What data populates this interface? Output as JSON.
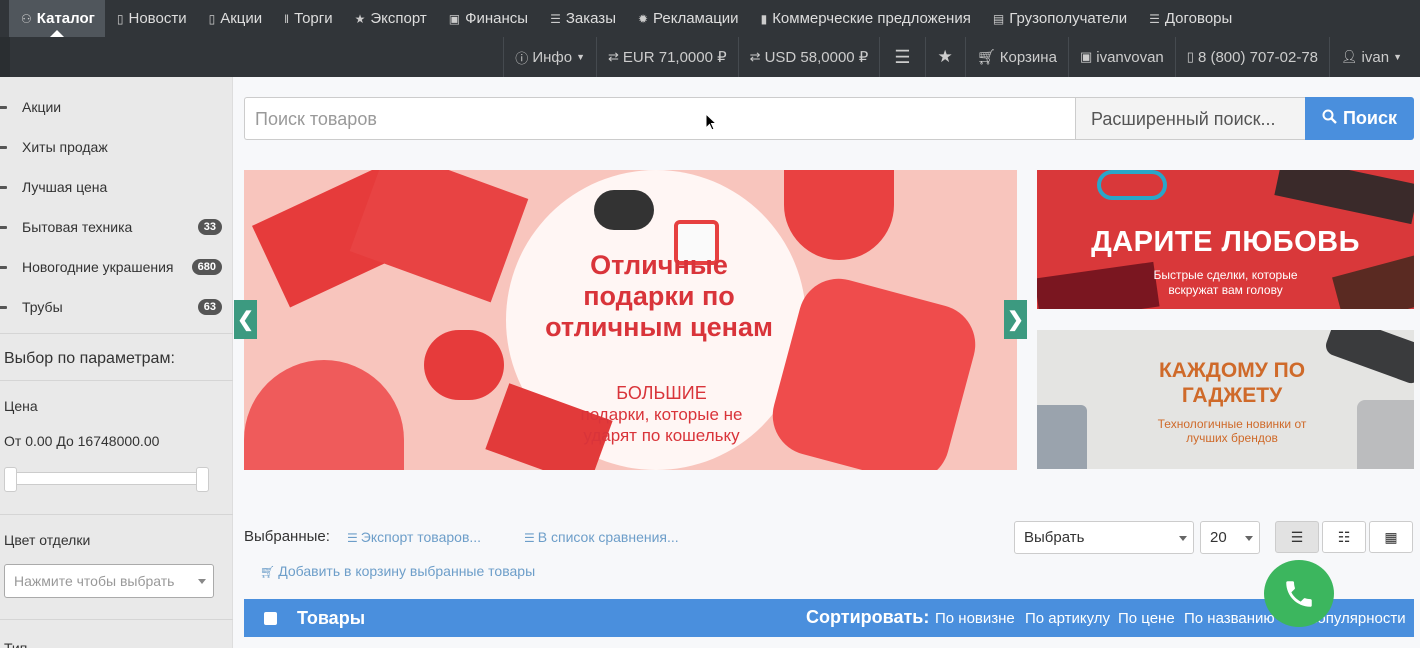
{
  "nav": {
    "items": [
      {
        "icon": "sitemap-icon",
        "glyph": "⚇",
        "label": "Каталог",
        "active": true
      },
      {
        "icon": "file-icon",
        "glyph": "▯",
        "label": "Новости"
      },
      {
        "icon": "file-text-icon",
        "glyph": "▯",
        "label": "Акции"
      },
      {
        "icon": "barcode-icon",
        "glyph": "‖",
        "label": "Торги"
      },
      {
        "icon": "star-icon",
        "glyph": "★",
        "label": "Экспорт"
      },
      {
        "icon": "money-icon",
        "glyph": "▣",
        "label": "Финансы"
      },
      {
        "icon": "list-icon",
        "glyph": "☰",
        "label": "Заказы"
      },
      {
        "icon": "gear-icon",
        "glyph": "✹",
        "label": "Рекламации"
      },
      {
        "icon": "bookmark-icon",
        "glyph": "▮",
        "label": "Коммерческие предложения"
      },
      {
        "icon": "building-icon",
        "glyph": "▤",
        "label": "Грузополучатели"
      },
      {
        "icon": "contract-icon",
        "glyph": "☰",
        "label": "Договоры"
      }
    ]
  },
  "subnav": {
    "info": "Инфо",
    "eur": "EUR 71,0000 ₽",
    "usd": "USD 58,0000 ₽",
    "cart": "Корзина",
    "company": "ivanvovan",
    "phone": "8 (800) 707-02-78",
    "user": "ivan"
  },
  "sidebar": {
    "categories": [
      {
        "label": "Акции",
        "count": null
      },
      {
        "label": "Хиты продаж",
        "count": null
      },
      {
        "label": "Лучшая цена",
        "count": null
      },
      {
        "label": "Бытовая техника",
        "count": "33"
      },
      {
        "label": "Новогодние украшения",
        "count": "680"
      },
      {
        "label": "Трубы",
        "count": "63"
      }
    ],
    "filter_title": "Выбор по параметрам:",
    "price_label": "Цена",
    "price_range": "От 0.00 До 16748000.00",
    "color_label": "Цвет отделки",
    "color_placeholder": "Нажмите чтобы выбрать",
    "type_label": "Тип"
  },
  "search": {
    "placeholder": "Поиск товаров",
    "advanced": "Расширенный поиск...",
    "button": "Поиск"
  },
  "banners": {
    "main_title": "Отличные подарки по отличным ценам",
    "main_sub_1": "БОЛЬШИЕ",
    "main_sub_2": "подарки, которые не ударят по кошельку",
    "prev": "❮",
    "next": "❯",
    "love_title": "ДАРИТЕ ЛЮБОВЬ",
    "love_sub": "Быстрые сделки, которые вскружат вам голову",
    "gadget_title": "КАЖДОМУ ПО ГАДЖЕТУ",
    "gadget_sub": "Технологичные новинки от лучших брендов"
  },
  "toolbar": {
    "selected_label": "Выбранные:",
    "export": "Экспорт товаров...",
    "compare": "В список сравнения...",
    "add_cart": "Добавить в корзину выбранные товары",
    "select_value": "Выбрать",
    "page_size": "20"
  },
  "table": {
    "title": "Товары",
    "sort_label": "Сортировать:",
    "sort_options": [
      "По новизне",
      "По артикулу",
      "По цене",
      "По названию",
      "По популярности"
    ]
  },
  "colors": {
    "accent": "#4a8fdd",
    "nav_bg": "#313539",
    "teal": "#3c9a80",
    "call": "#3cb65e"
  }
}
